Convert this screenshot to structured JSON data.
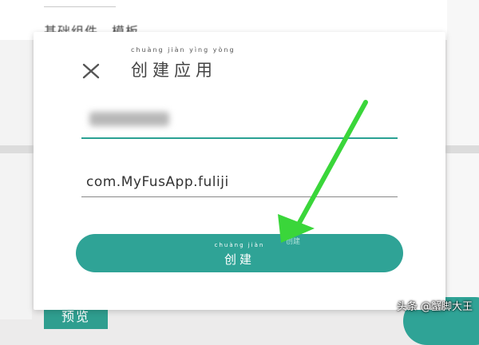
{
  "background": {
    "top_text": "基础组件、模板",
    "bottom_button_label": "预览"
  },
  "dialog": {
    "close_icon": "close-icon",
    "title": "创建应用",
    "title_pinyin": "chuàng jiàn yìng yòng",
    "app_name_value": "",
    "package_name_value": "com.MyFusApp.fuliji",
    "create_button": {
      "label": "创建",
      "pinyin": "chuàng jiàn",
      "ghost_text": "创建"
    }
  },
  "annotation": {
    "type": "arrow",
    "color": "#3ad63a"
  },
  "watermark": "头条 @蟹脚大王",
  "colors": {
    "accent": "#2fa396",
    "underline_active": "#2aa193",
    "arrow": "#3ad63a"
  }
}
